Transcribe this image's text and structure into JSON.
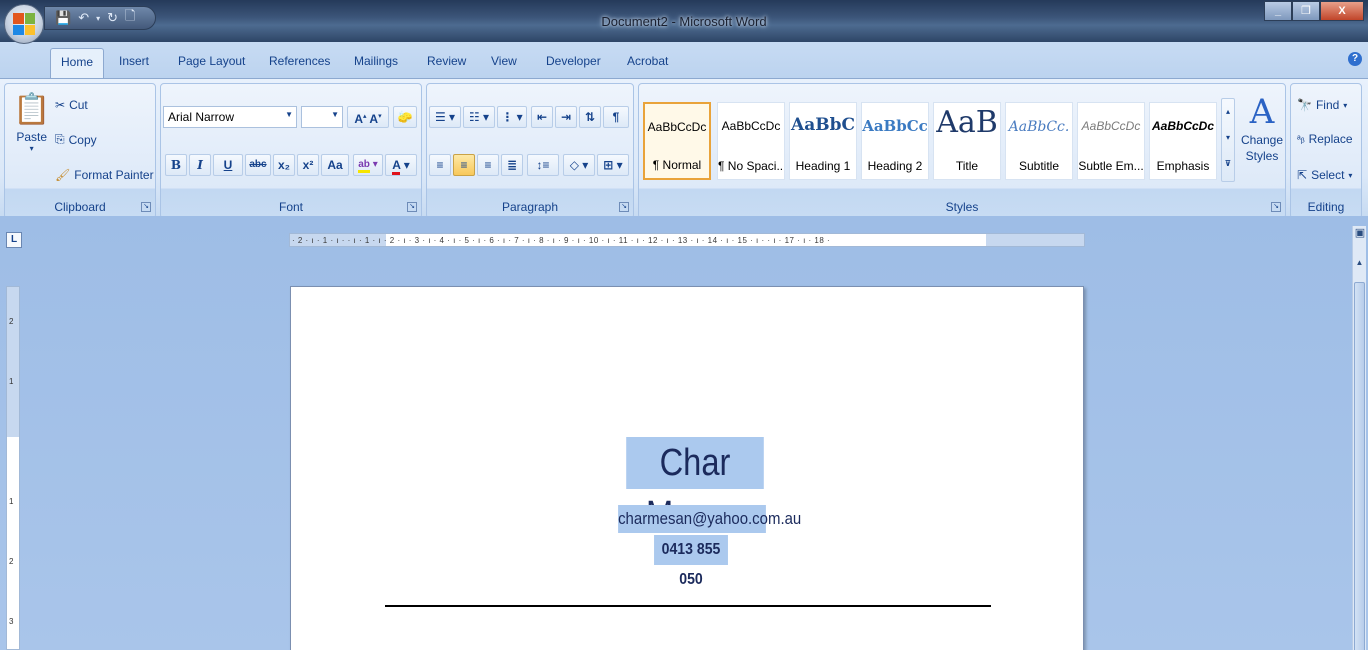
{
  "window": {
    "title": "Document2 - Microsoft Word"
  },
  "tabs": [
    "Home",
    "Insert",
    "Page Layout",
    "References",
    "Mailings",
    "Review",
    "View",
    "Developer",
    "Acrobat"
  ],
  "clipboard": {
    "paste": "Paste",
    "cut": "Cut",
    "copy": "Copy",
    "format_painter": "Format Painter",
    "label": "Clipboard"
  },
  "font": {
    "name": "Arial Narrow",
    "size": "",
    "label": "Font",
    "bold": "B",
    "italic": "I",
    "underline": "U",
    "strike": "abc",
    "sub": "x₂",
    "sup": "x²",
    "case": "Aa",
    "grow": "A",
    "shrink": "A"
  },
  "paragraph": {
    "label": "Paragraph",
    "pilcrow": "¶"
  },
  "styles": {
    "label": "Styles",
    "items": [
      {
        "sample": "AaBbCcDc",
        "name": "¶ Normal"
      },
      {
        "sample": "AaBbCcDc",
        "name": "¶ No Spaci..."
      },
      {
        "sample": "AaBbC",
        "name": "Heading 1"
      },
      {
        "sample": "AaBbCc",
        "name": "Heading 2"
      },
      {
        "sample": "AaB",
        "name": "Title"
      },
      {
        "sample": "AaBbCc.",
        "name": "Subtitle"
      },
      {
        "sample": "AaBbCcDc",
        "name": "Subtle Em..."
      },
      {
        "sample": "AaBbCcDc",
        "name": "Emphasis"
      }
    ],
    "change_styles": "Change Styles"
  },
  "editing": {
    "label": "Editing",
    "find": "Find",
    "replace": "Replace",
    "select": "Select"
  },
  "ruler": {
    "marks": "· 2 · ı · 1 · ı ·   · ı · 1 · ı · 2 · ı · 3 · ı · 4 · ı · 5 · ı · 6 · ı · 7 · ı · 8 · ı · 9 · ı · 10 · ı · 11 · ı · 12 · ı · 13 · ı · 14 · ı · 15 · ı ·   · ı · 17 · ı · 18 ·"
  },
  "document": {
    "name": "Char Mesan",
    "email": "charmesan@yahoo.com.au",
    "phone": "0413 855 050"
  }
}
